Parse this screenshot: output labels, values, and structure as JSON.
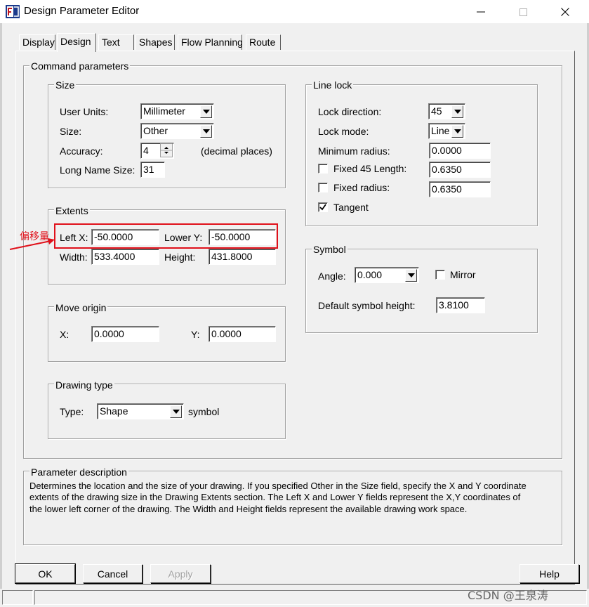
{
  "window": {
    "title": "Design Parameter Editor",
    "buttons": {
      "minimize": "minimize-icon",
      "maximize": "maximize-icon",
      "close": "close-icon"
    }
  },
  "tabs": [
    "Display",
    "Design",
    "Text",
    "Shapes",
    "Flow Planning",
    "Route"
  ],
  "active_tab": "Design",
  "command_parameters": {
    "title": "Command parameters",
    "size_group": {
      "title": "Size",
      "user_units_label": "User Units:",
      "user_units_value": "Millimeter",
      "size_label": "Size:",
      "size_value": "Other",
      "accuracy_label": "Accuracy:",
      "accuracy_value": "4",
      "accuracy_suffix": "(decimal places)",
      "long_name_label": "Long Name Size:",
      "long_name_value": "31"
    },
    "extents_group": {
      "title": "Extents",
      "left_x_label": "Left X:",
      "left_x_value": "-50.0000",
      "lower_y_label": "Lower Y:",
      "lower_y_value": "-50.0000",
      "width_label": "Width:",
      "width_value": "533.4000",
      "height_label": "Height:",
      "height_value": "431.8000"
    },
    "move_origin_group": {
      "title": "Move origin",
      "x_label": "X:",
      "x_value": "0.0000",
      "y_label": "Y:",
      "y_value": "0.0000"
    },
    "drawing_type_group": {
      "title": "Drawing type",
      "type_label": "Type:",
      "type_value": "Shape",
      "suffix": "symbol"
    },
    "line_lock_group": {
      "title": "Line lock",
      "lock_direction_label": "Lock direction:",
      "lock_direction_value": "45",
      "lock_mode_label": "Lock mode:",
      "lock_mode_value": "Line",
      "min_radius_label": "Minimum radius:",
      "min_radius_value": "0.0000",
      "fixed45_label": "Fixed 45 Length:",
      "fixed45_checked": false,
      "fixed45_value": "0.6350",
      "fixed_radius_label": "Fixed radius:",
      "fixed_radius_checked": false,
      "fixed_radius_value": "0.6350",
      "tangent_label": "Tangent",
      "tangent_checked": true
    },
    "symbol_group": {
      "title": "Symbol",
      "angle_label": "Angle:",
      "angle_value": "0.000",
      "mirror_label": "Mirror",
      "mirror_checked": false,
      "default_height_label": "Default symbol height:",
      "default_height_value": "3.8100"
    }
  },
  "parameter_description": {
    "title": "Parameter description",
    "lines": [
      "Determines the location and the size of your drawing.  If you specified Other in the Size field, specify the X and Y coordinate",
      "extents of the drawing size in the Drawing Extents section. The Left X and Lower Y fields represent the X,Y coordinates of",
      "the lower left corner of the drawing.  The Width and Height fields represent the available drawing work space."
    ]
  },
  "footer_buttons": {
    "ok": "OK",
    "cancel": "Cancel",
    "apply": "Apply",
    "help": "Help"
  },
  "annotation": {
    "text": "偏移量",
    "color": "#e0101a"
  },
  "watermark": "CSDN @王泉涛",
  "colors": {
    "dialog_bg": "#f0f0f0",
    "highlight": "#e0101a"
  }
}
